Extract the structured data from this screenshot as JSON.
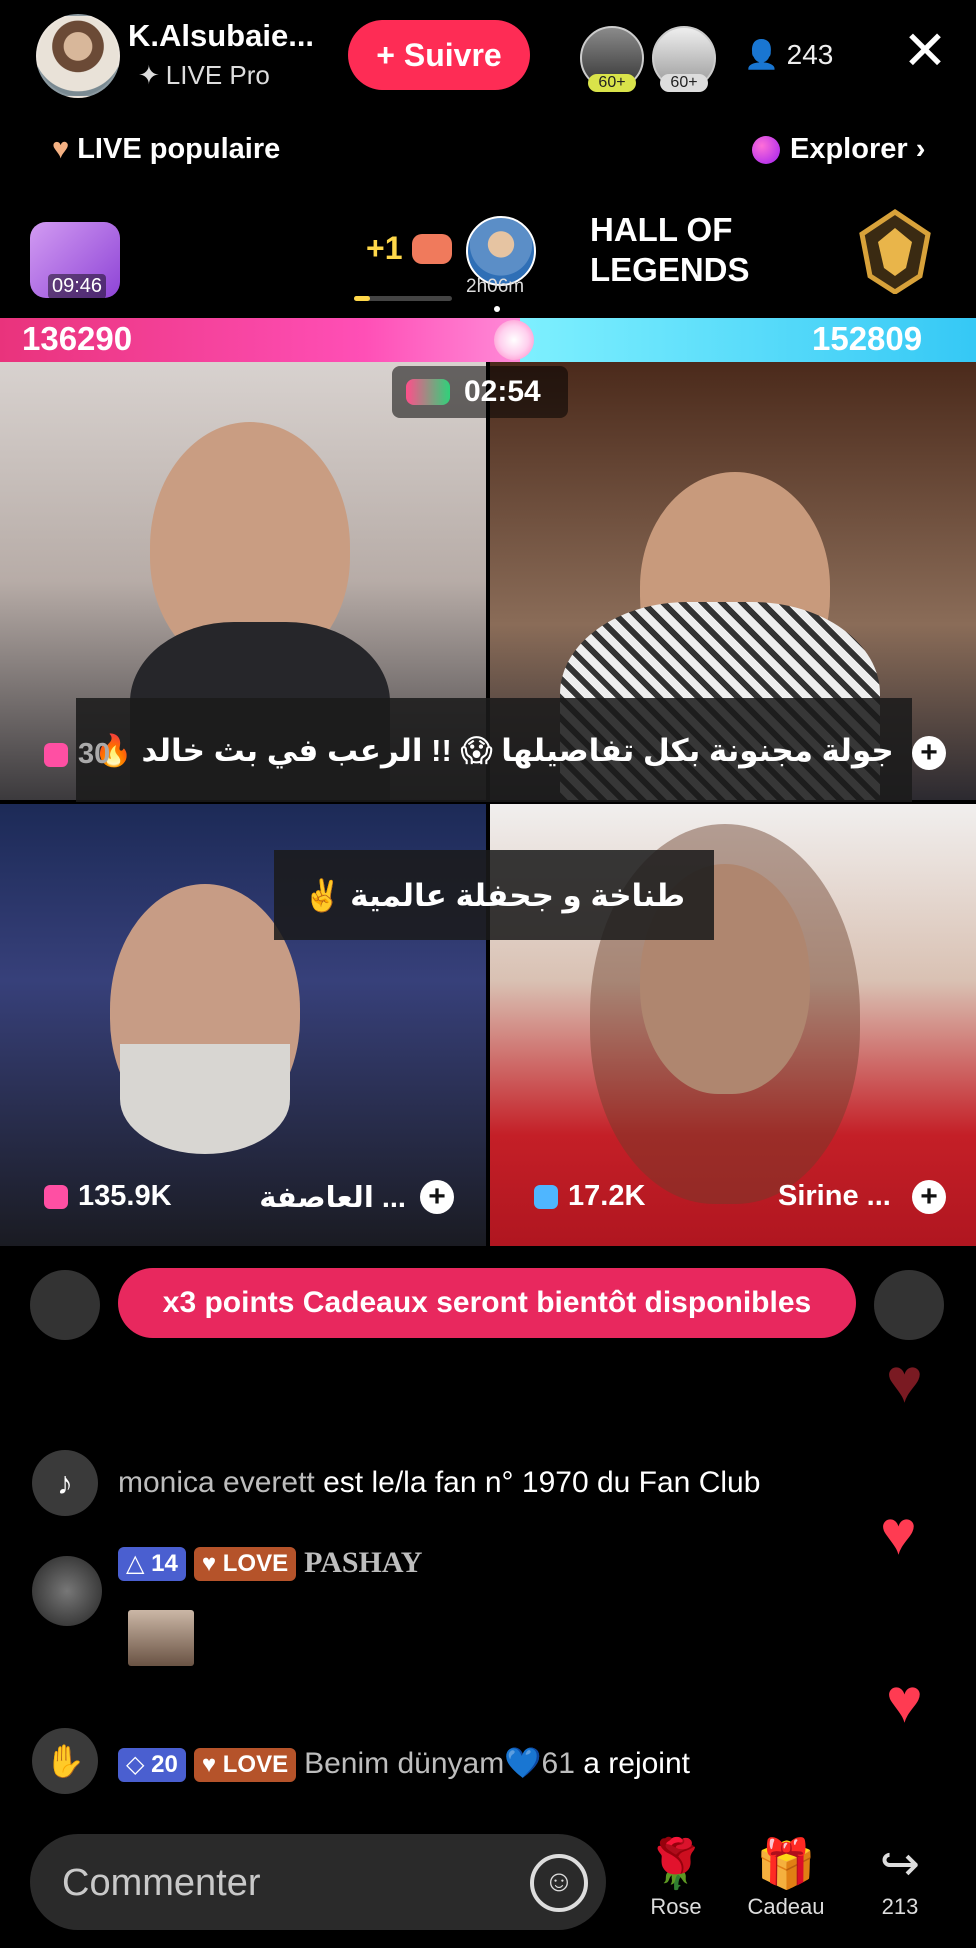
{
  "header": {
    "host_name": "K.Alsubaie...",
    "host_subtitle": "LIVE Pro",
    "follow_label": "+ Suivre",
    "badges": [
      {
        "level": "60+"
      },
      {
        "level": "60+"
      }
    ],
    "viewer_count": "243",
    "live_popular_label": "LIVE populaire",
    "explore_label": "Explorer"
  },
  "event_row": {
    "gift_timer": "09:46",
    "plus_count": "+1",
    "duration": "2h06m",
    "hall_title_line1": "HALL OF",
    "hall_title_line2": "LEGENDS"
  },
  "battle": {
    "score_left": "136290",
    "score_right": "152809",
    "timer": "02:54"
  },
  "tiles": [
    {
      "score": "30",
      "name": ""
    },
    {
      "score": "",
      "name": ""
    },
    {
      "score": "135.9K",
      "name": "العاصفة ..."
    },
    {
      "score": "17.2K",
      "name": "Sirine ..."
    }
  ],
  "overlays": {
    "caption1": "جولة مجنونة بكل تفاصيلها 😱 !! الرعب في بث خالد 🔥",
    "caption2": "طناخة و جحفلة عالمية ✌️"
  },
  "chat": {
    "notice": "x3 points Cadeaux seront bientôt disponibles",
    "msg1_user": "monica everett",
    "msg1_text": "est le/la fan n° 1970 du Fan Club",
    "msg2_level": "14",
    "msg2_love": "LOVE",
    "msg2_user": "PASHAY",
    "msg3_level": "20",
    "msg3_love": "LOVE",
    "msg3_user": "Benim dünyam💙61",
    "msg3_text": "a rejoint"
  },
  "bottom": {
    "comment_placeholder": "Commenter",
    "rose_label": "Rose",
    "gift_label": "Cadeau",
    "share_count": "213"
  },
  "colors": {
    "accent": "#fe2c55",
    "battle_left": "#e9337c",
    "battle_right": "#35c8f5"
  }
}
